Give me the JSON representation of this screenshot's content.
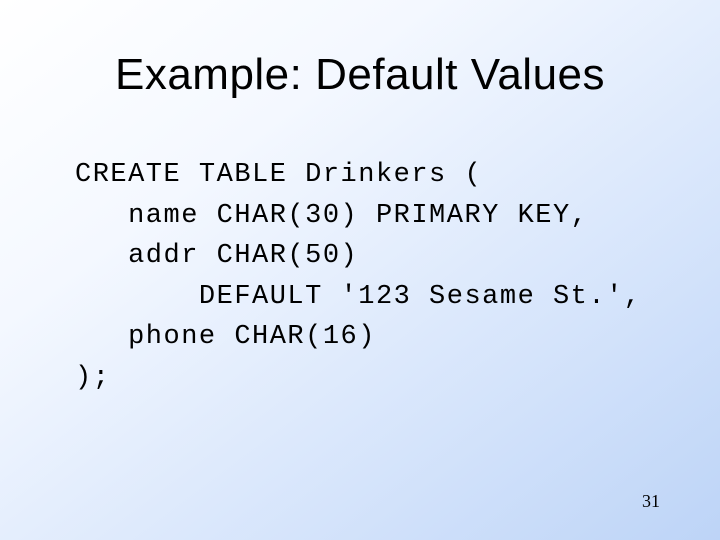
{
  "title": "Example: Default Values",
  "code": {
    "l1": "CREATE TABLE Drinkers (",
    "l2": "   name CHAR(30) PRIMARY KEY,",
    "l3": "   addr CHAR(50)",
    "l4": "       DEFAULT '123 Sesame St.',",
    "l5": "   phone CHAR(16)",
    "l6": ");"
  },
  "page_number": "31"
}
